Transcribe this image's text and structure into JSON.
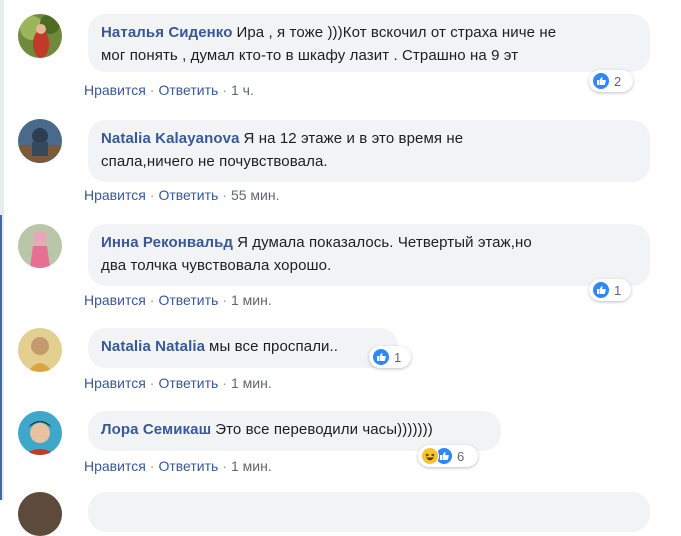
{
  "action_like": "Нравится",
  "action_reply": "Ответить",
  "separator": "·",
  "comments": [
    {
      "author": "Наталья Сиденко",
      "line1": "Ира , я тоже )))Кот вскочил от страха ниче не",
      "line2": "мог понять , думал кто-то в шкафу лазит . Страшно на 9 эт",
      "time": "1 ч.",
      "reactions": "2"
    },
    {
      "author": "Natalia Kalayanova",
      "line1": "Я на 12 этаже и в это время не",
      "line2": "спала,ничего не почувствовала.",
      "time": "55 мин."
    },
    {
      "author": "Инна Реконвальд",
      "line1": "Я думала показалось. Четвертый этаж,но",
      "line2": "два толчка чувствовала хорошо.",
      "time": "1 мин.",
      "reactions": "1"
    },
    {
      "author": "Natalia Natalia",
      "line1": "мы все проспали..",
      "time": "1 мин.",
      "reactions": "1"
    },
    {
      "author": "Лора Семикаш",
      "line1": "Это все переводили часы)))))))",
      "time": "1 мин.",
      "reactions": "6"
    }
  ],
  "colors": {
    "link": "#385898",
    "bubble": "#f2f3f5",
    "like": "#2d88ff",
    "haha": "#f7c32f"
  }
}
